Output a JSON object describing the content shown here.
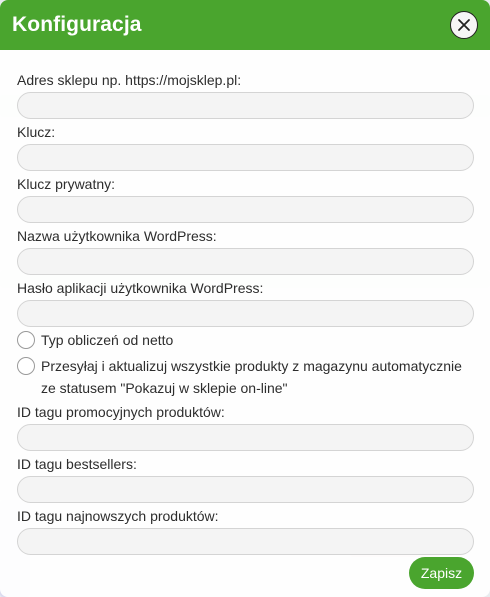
{
  "modal": {
    "title": "Konfiguracja",
    "close_icon": "close-icon",
    "accent_color": "#4aa52e"
  },
  "fields": {
    "shop_url": {
      "label": "Adres sklepu np. https://mojsklep.pl:",
      "value": ""
    },
    "key": {
      "label": "Klucz:",
      "value": ""
    },
    "private_key": {
      "label": "Klucz prywatny:",
      "value": ""
    },
    "wp_username": {
      "label": "Nazwa użytkownika WordPress:",
      "value": ""
    },
    "wp_app_password": {
      "label": "Hasło aplikacji użytkownika WordPress:",
      "value": ""
    },
    "promo_tag_id": {
      "label": "ID tagu promocyjnych produktów:",
      "value": ""
    },
    "bestsellers_tag_id": {
      "label": "ID tagu bestsellers:",
      "value": ""
    },
    "newest_tag_id": {
      "label": "ID tagu najnowszych produktów:",
      "value": ""
    }
  },
  "options": {
    "net_calc": {
      "label": "Typ obliczeń od netto",
      "checked": false
    },
    "auto_sync": {
      "label": "Przesyłaj i aktualizuj wszystkie produkty z magazynu automatycznie ze statusem \"Pokazuj w sklepie on-line\"",
      "checked": false
    }
  },
  "actions": {
    "save_label": "Zapisz"
  }
}
